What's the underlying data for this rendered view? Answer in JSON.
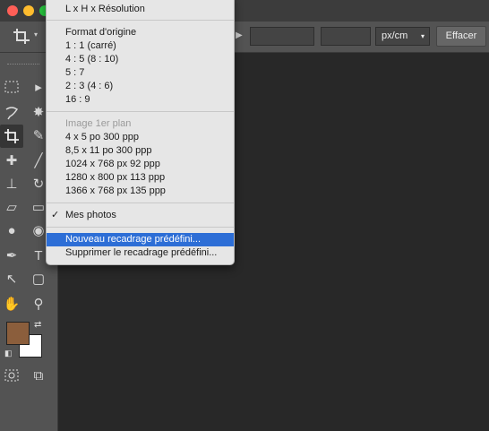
{
  "window": {
    "controls": [
      "close",
      "minimize",
      "zoom"
    ],
    "colors": {
      "close": "#ff5f57",
      "minimize": "#febc2e",
      "zoom": "#28c840"
    }
  },
  "options_bar": {
    "crop_tool_icon": "crop-icon",
    "unit_select": "px/cm",
    "clear_label": "Effacer"
  },
  "menu": {
    "item_top": "L x H x Résolution",
    "group_original": [
      "Format d'origine",
      "1 : 1 (carré)",
      "4 : 5 (8 : 10)",
      "5 : 7",
      "2 : 3 (4 : 6)",
      "16 : 9"
    ],
    "group_image_label": "Image 1er plan",
    "group_image": [
      "4 x 5 po 300 ppp",
      "8,5 x 11 po 300 ppp",
      "1024 x 768 px 92 ppp",
      "1280 x 800 px 113 ppp",
      "1366 x 768 px 135 ppp"
    ],
    "my_photos": "Mes photos",
    "new_preset": "Nouveau recadrage prédéfini...",
    "delete_preset": "Supprimer le recadrage prédéfini..."
  },
  "colors": {
    "foreground": "#8b5e3c",
    "background": "#ffffff",
    "menu_highlight": "#2d6ed6"
  }
}
